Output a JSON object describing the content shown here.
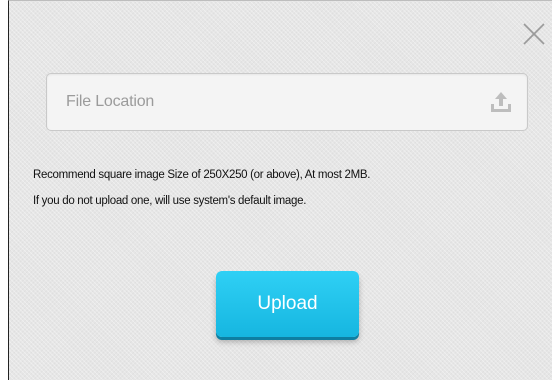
{
  "dialog": {
    "close_icon": "close-icon",
    "file_field": {
      "placeholder": "File Location",
      "icon": "upload-tray-icon"
    },
    "hints": [
      "Recommend square image Size of 250X250 (or above), At most 2MB.",
      "If you do not upload one, will use system's default image."
    ],
    "upload_button_label": "Upload"
  },
  "colors": {
    "accent": "#1ec3ea",
    "background": "#e6e6e6"
  }
}
